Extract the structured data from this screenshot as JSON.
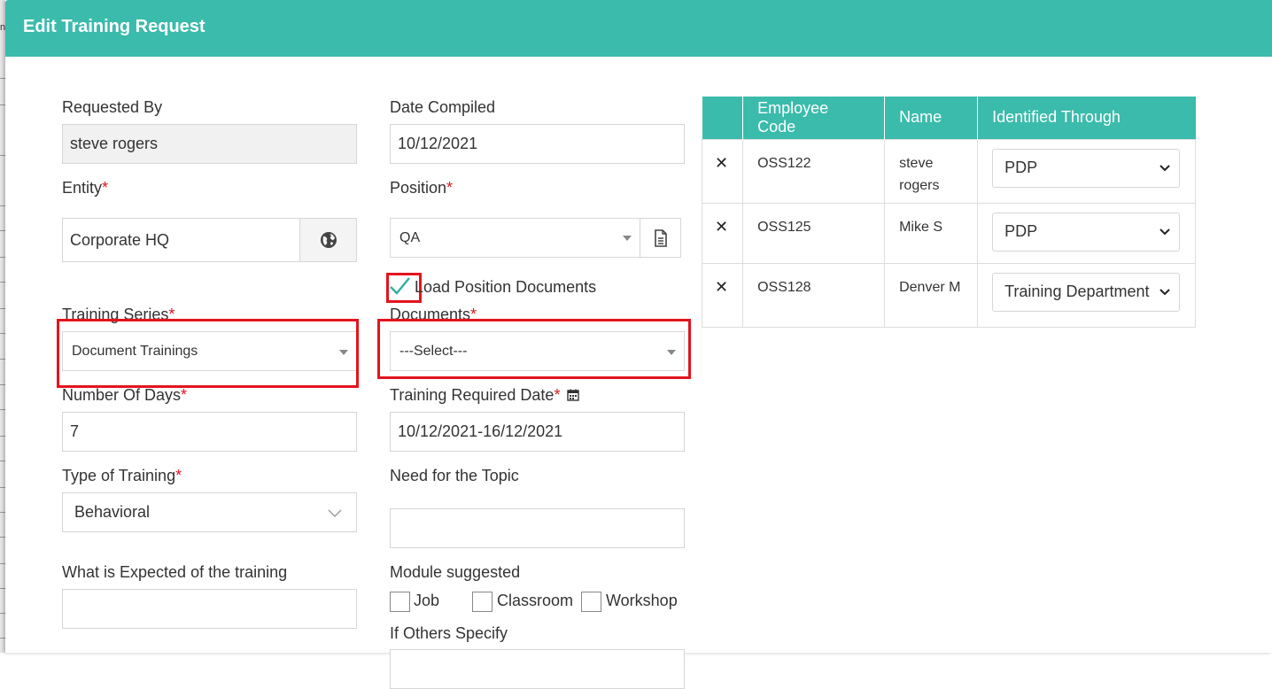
{
  "modal": {
    "title": "Edit Training Request"
  },
  "form": {
    "requested_by": {
      "label": "Requested By",
      "value": "steve rogers"
    },
    "date_compiled": {
      "label": "Date Compiled",
      "value": "10/12/2021"
    },
    "entity": {
      "label": "Entity",
      "required": "*",
      "value": "Corporate HQ"
    },
    "position": {
      "label": "Position",
      "required": "*",
      "value": "QA"
    },
    "load_position_documents": {
      "label": "Load Position Documents",
      "checked": true
    },
    "training_series": {
      "label": "Training Series",
      "required": "*",
      "value": "Document Trainings"
    },
    "documents": {
      "label": "Documents",
      "required": "*",
      "value": "---Select---"
    },
    "number_of_days": {
      "label": "Number Of Days",
      "required": "*",
      "value": "7"
    },
    "training_required_date": {
      "label": "Training Required Date",
      "required": "*",
      "value": "10/12/2021-16/12/2021"
    },
    "type_of_training": {
      "label": "Type of Training",
      "required": "*",
      "value": "Behavioral"
    },
    "need_for_topic": {
      "label": "Need for the Topic",
      "value": ""
    },
    "expected_of_training": {
      "label": "What is Expected of the training",
      "value": ""
    },
    "module_suggested": {
      "label": "Module suggested",
      "options": [
        "Job",
        "Classroom",
        "Workshop"
      ]
    },
    "if_others_specify": {
      "label": "If Others Specify"
    }
  },
  "employees": {
    "headers": [
      "",
      "Employee Code",
      "Name",
      "Identified Through"
    ],
    "rows": [
      {
        "code": "OSS122",
        "name": "steve rogers",
        "identified": "PDP"
      },
      {
        "code": "OSS125",
        "name": "Mike S",
        "identified": "PDP"
      },
      {
        "code": "OSS128",
        "name": "Denver M",
        "identified": "Training Department"
      }
    ]
  },
  "colors": {
    "header": "#3bbbab",
    "highlight": "#e3141e",
    "required": "#e0161f",
    "check": "#2fae9e"
  },
  "icons": [
    "globe-icon",
    "document-icon",
    "calendar-icon",
    "close-icon",
    "chevron-down-icon",
    "caret-down-icon",
    "checkmark-icon"
  ]
}
